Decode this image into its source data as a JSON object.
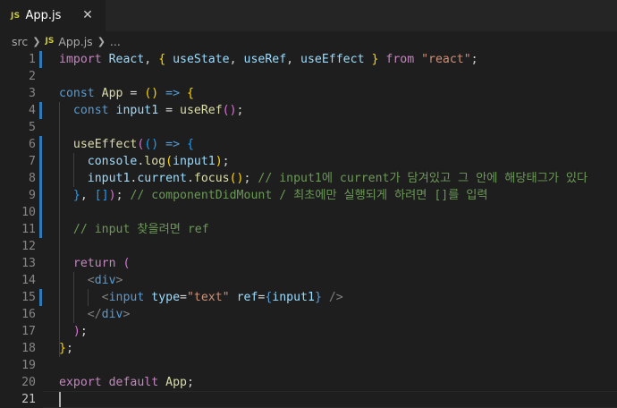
{
  "tab": {
    "badge": "JS",
    "filename": "App.js",
    "close_glyph": "✕"
  },
  "breadcrumb": {
    "folder": "src",
    "badge": "JS",
    "file": "App.js",
    "more": "..."
  },
  "editor": {
    "line_numbers": [
      "1",
      "2",
      "3",
      "4",
      "5",
      "6",
      "7",
      "8",
      "9",
      "10",
      "11",
      "12",
      "13",
      "14",
      "15",
      "16",
      "17",
      "18",
      "19",
      "20",
      "21"
    ],
    "modified_lines": [
      1,
      4,
      6,
      7,
      8,
      9,
      10,
      11,
      15
    ],
    "active_line": 21,
    "lines": [
      [
        [
          "kw-purple",
          "import"
        ],
        [
          "plain",
          " "
        ],
        [
          "ident",
          "React"
        ],
        [
          "plain",
          ", "
        ],
        [
          "br-gold",
          "{"
        ],
        [
          "plain",
          " "
        ],
        [
          "ident",
          "useState"
        ],
        [
          "plain",
          ", "
        ],
        [
          "ident",
          "useRef"
        ],
        [
          "plain",
          ", "
        ],
        [
          "ident",
          "useEffect"
        ],
        [
          "plain",
          " "
        ],
        [
          "br-gold",
          "}"
        ],
        [
          "plain",
          " "
        ],
        [
          "kw-purple",
          "from"
        ],
        [
          "plain",
          " "
        ],
        [
          "str",
          "\"react\""
        ],
        [
          "plain",
          ";"
        ]
      ],
      [],
      [
        [
          "kw-blue",
          "const"
        ],
        [
          "plain",
          " "
        ],
        [
          "fn",
          "App"
        ],
        [
          "plain",
          " = "
        ],
        [
          "br-gold",
          "()"
        ],
        [
          "plain",
          " "
        ],
        [
          "kw-blue",
          "=>"
        ],
        [
          "plain",
          " "
        ],
        [
          "br-gold",
          "{"
        ]
      ],
      [
        [
          "plain",
          "  "
        ],
        [
          "kw-blue",
          "const"
        ],
        [
          "plain",
          " "
        ],
        [
          "ident",
          "input1"
        ],
        [
          "plain",
          " = "
        ],
        [
          "fn",
          "useRef"
        ],
        [
          "br-pink",
          "()"
        ],
        [
          "plain",
          ";"
        ]
      ],
      [],
      [
        [
          "plain",
          "  "
        ],
        [
          "fn",
          "useEffect"
        ],
        [
          "br-pink",
          "("
        ],
        [
          "br-cyan",
          "()"
        ],
        [
          "plain",
          " "
        ],
        [
          "kw-blue",
          "=>"
        ],
        [
          "plain",
          " "
        ],
        [
          "br-cyan",
          "{"
        ]
      ],
      [
        [
          "plain",
          "    "
        ],
        [
          "ident",
          "console"
        ],
        [
          "plain",
          "."
        ],
        [
          "fn",
          "log"
        ],
        [
          "br-gold",
          "("
        ],
        [
          "ident",
          "input1"
        ],
        [
          "br-gold",
          ")"
        ],
        [
          "plain",
          ";"
        ]
      ],
      [
        [
          "plain",
          "    "
        ],
        [
          "ident",
          "input1"
        ],
        [
          "plain",
          "."
        ],
        [
          "ident",
          "current"
        ],
        [
          "plain",
          "."
        ],
        [
          "fn",
          "focus"
        ],
        [
          "br-gold",
          "()"
        ],
        [
          "plain",
          "; "
        ],
        [
          "cmt",
          "// input1에 current가 담겨있고 그 안에 해당태그가 있다"
        ]
      ],
      [
        [
          "plain",
          "  "
        ],
        [
          "br-cyan",
          "}"
        ],
        [
          "plain",
          ", "
        ],
        [
          "br-cyan",
          "[]"
        ],
        [
          "br-pink",
          ")"
        ],
        [
          "plain",
          "; "
        ],
        [
          "cmt",
          "// componentDidMount / 최초에만 실행되게 하려면 []를 입력"
        ]
      ],
      [],
      [
        [
          "plain",
          "  "
        ],
        [
          "cmt",
          "// input 찾을려면 ref"
        ]
      ],
      [],
      [
        [
          "plain",
          "  "
        ],
        [
          "kw-purple",
          "return"
        ],
        [
          "plain",
          " "
        ],
        [
          "br-pink",
          "("
        ]
      ],
      [
        [
          "plain",
          "    "
        ],
        [
          "tagbr",
          "<"
        ],
        [
          "tag",
          "div"
        ],
        [
          "tagbr",
          ">"
        ]
      ],
      [
        [
          "plain",
          "      "
        ],
        [
          "tagbr",
          "<"
        ],
        [
          "tag",
          "input"
        ],
        [
          "plain",
          " "
        ],
        [
          "attr",
          "type"
        ],
        [
          "plain",
          "="
        ],
        [
          "str",
          "\"text\""
        ],
        [
          "plain",
          " "
        ],
        [
          "attr",
          "ref"
        ],
        [
          "plain",
          "="
        ],
        [
          "kw-blue",
          "{"
        ],
        [
          "ident",
          "input1"
        ],
        [
          "kw-blue",
          "}"
        ],
        [
          "plain",
          " "
        ],
        [
          "tagbr",
          "/>"
        ]
      ],
      [
        [
          "plain",
          "    "
        ],
        [
          "tagbr",
          "</"
        ],
        [
          "tag",
          "div"
        ],
        [
          "tagbr",
          ">"
        ]
      ],
      [
        [
          "plain",
          "  "
        ],
        [
          "br-pink",
          ")"
        ],
        [
          "plain",
          ";"
        ]
      ],
      [
        [
          "br-gold",
          "}"
        ],
        [
          "plain",
          ";"
        ]
      ],
      [],
      [
        [
          "kw-purple",
          "export"
        ],
        [
          "plain",
          " "
        ],
        [
          "kw-purple",
          "default"
        ],
        [
          "plain",
          " "
        ],
        [
          "fn",
          "App"
        ],
        [
          "plain",
          ";"
        ]
      ],
      []
    ]
  }
}
